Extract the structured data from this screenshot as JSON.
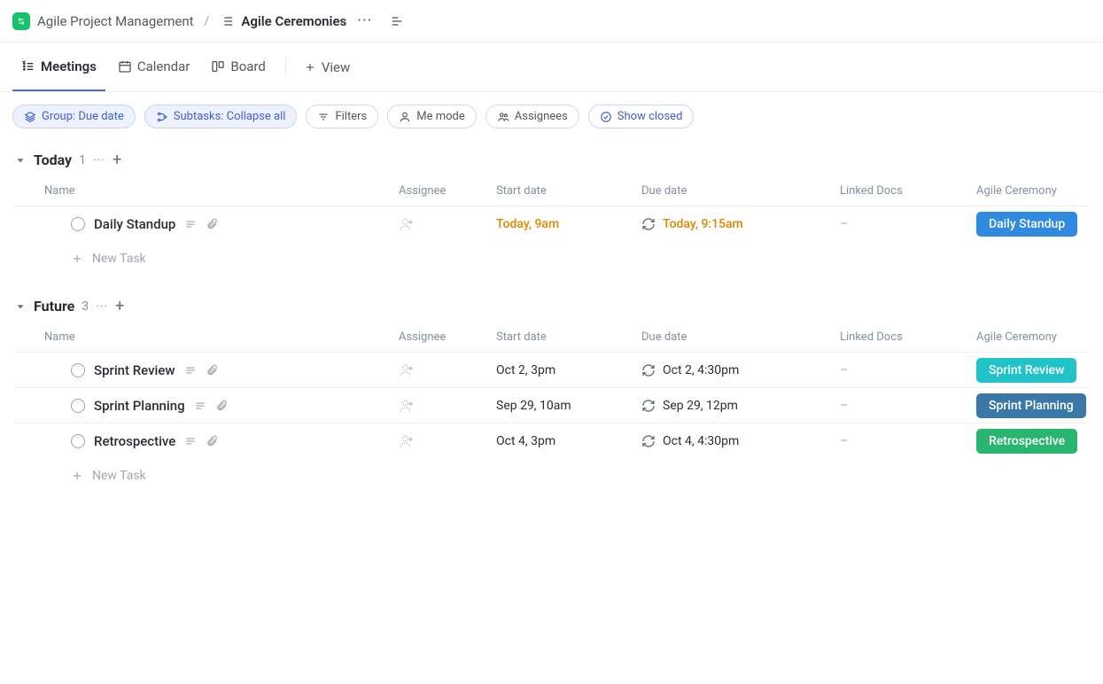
{
  "breadcrumb": {
    "project": "Agile Project Management",
    "page": "Agile Ceremonies"
  },
  "tabs": [
    {
      "label": "Meetings",
      "icon": "list",
      "active": true
    },
    {
      "label": "Calendar",
      "icon": "calendar",
      "active": false
    },
    {
      "label": "Board",
      "icon": "board",
      "active": false
    }
  ],
  "add_view_label": "View",
  "chips": {
    "group": "Group: Due date",
    "subtasks": "Subtasks: Collapse all",
    "filters": "Filters",
    "me_mode": "Me mode",
    "assignees": "Assignees",
    "show_closed": "Show closed"
  },
  "columns": {
    "name": "Name",
    "assignee": "Assignee",
    "start": "Start date",
    "due": "Due date",
    "docs": "Linked Docs",
    "ceremony": "Agile Ceremony"
  },
  "new_task_label": "New Task",
  "empty_docs": "–",
  "groups": [
    {
      "title": "Today",
      "count": "1",
      "tasks": [
        {
          "name": "Daily Standup",
          "start": "Today, 9am",
          "due": "Today, 9:15am",
          "date_color": "orange",
          "badge": {
            "text": "Daily Standup",
            "color": "#2f8ae0"
          }
        }
      ]
    },
    {
      "title": "Future",
      "count": "3",
      "tasks": [
        {
          "name": "Sprint Review",
          "start": "Oct 2, 3pm",
          "due": "Oct 2, 4:30pm",
          "date_color": "normal",
          "badge": {
            "text": "Sprint Review",
            "color": "#1fc3c8"
          }
        },
        {
          "name": "Sprint Planning",
          "start": "Sep 29, 10am",
          "due": "Sep 29, 12pm",
          "date_color": "normal",
          "badge": {
            "text": "Sprint Planning",
            "color": "#3a78a8"
          }
        },
        {
          "name": "Retrospective",
          "start": "Oct 4, 3pm",
          "due": "Oct 4, 4:30pm",
          "date_color": "normal",
          "badge": {
            "text": "Retrospective",
            "color": "#27b56f"
          }
        }
      ]
    }
  ]
}
